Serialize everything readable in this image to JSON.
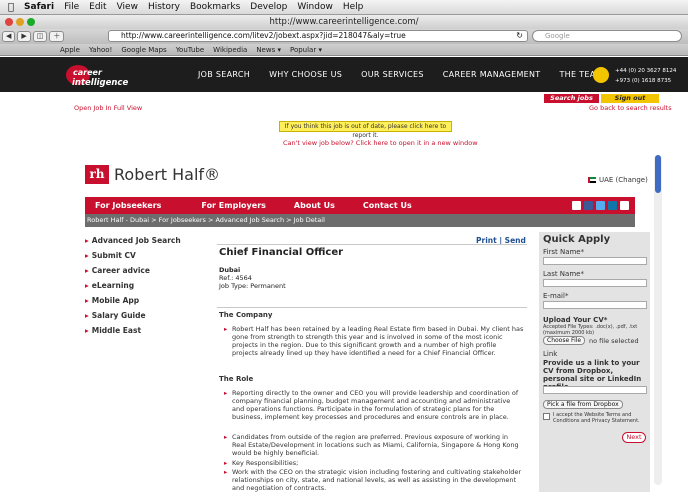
{
  "system": {
    "apple": "",
    "app": "Safari",
    "menus": [
      "File",
      "Edit",
      "View",
      "History",
      "Bookmarks",
      "Develop",
      "Window",
      "Help"
    ]
  },
  "browser": {
    "title": "http://www.careerintelligence.com/",
    "url": "http://www.careerintelligence.com/litev2/jobext.aspx?jid=218047&aly=true",
    "search_placeholder": "Google",
    "bookmarks": [
      "Apple",
      "Yahoo!",
      "Google Maps",
      "YouTube",
      "Wikipedia",
      "News ▾",
      "Popular ▾"
    ]
  },
  "site": {
    "logo_top": "career",
    "logo_bottom": "intelligence",
    "nav": [
      "JOB SEARCH",
      "WHY CHOOSE US",
      "OUR SERVICES",
      "CAREER MANAGEMENT",
      "THE TEAM"
    ],
    "phone1": "+44 (0) 20 3627 8124",
    "phone2": "+973 (0) 1618 8735",
    "open_full": "Open Job In Full View",
    "search_jobs": "Search jobs",
    "sign_out": "Sign out",
    "go_back": "Go back to search results",
    "notice": "If you think this job is out of date, please click here to report it.",
    "cant_view": "Can't view job below? Click here to open it in a new window"
  },
  "rh": {
    "logo_box": "rh",
    "logo_text": "Robert Half®",
    "region": "UAE (Change)",
    "nav": [
      "For Jobseekers",
      "For Employers",
      "About Us",
      "Contact Us"
    ],
    "breadcrumb": "Robert Half - Dubai > For Jobseekers > Advanced Job Search > Job Detail",
    "leftmenu": [
      "Advanced Job Search",
      "Submit CV",
      "Career advice",
      "eLearning",
      "Mobile App",
      "Salary Guide",
      "Middle East"
    ],
    "print": "Print",
    "send": "Send",
    "job_title": "Chief Financial Officer",
    "location": "Dubai",
    "ref": "Ref.: 4564",
    "type": "Job Type: Permanent",
    "company_h": "The Company",
    "company_p": "Robert Half has been retained by a leading Real Estate firm based in Dubai. My client has gone from strength to strength this year and is involved in some of the most iconic projects in the region. Due to this significant growth and a number of high profile projects already lined up they have identified a need for a Chief Financial Officer.",
    "role_h": "The Role",
    "role_items": [
      "Reporting directly to the owner and CEO you will provide leadership and coordination of company financial planning, budget management and accounting and administrative and operations functions. Participate in the formulation of strategic plans for the business, implement key processes and procedures and ensure controls are in place.",
      "Candidates from outside of the region are preferred. Previous exposure of working in Real Estate/Development in locations such as Miami, California, Singapore & Hong Kong would be highly beneficial.",
      "Key Responsibilities;",
      "Work with the CEO on the strategic vision including fostering and cultivating stakeholder relationships on city, state, and national levels, as well as assisting in the development and negotiation of contracts."
    ]
  },
  "apply": {
    "title": "Quick Apply",
    "first": "First Name*",
    "last": "Last Name*",
    "email": "E-mail*",
    "upload": "Upload Your CV*",
    "accepted": "Accepted File Types: .doc(x), .pdf, .txt (maximum 2000 kb)",
    "choose": "Choose File",
    "nofile": "no file selected",
    "link": "Link",
    "provide": "Provide us a link to your CV from Dropbox, personal site or LinkedIn profile",
    "dropbox": "Pick a file from Dropbox",
    "terms": "I accept the Website Terms and Conditions and Privacy Statement.",
    "next": "Next"
  }
}
